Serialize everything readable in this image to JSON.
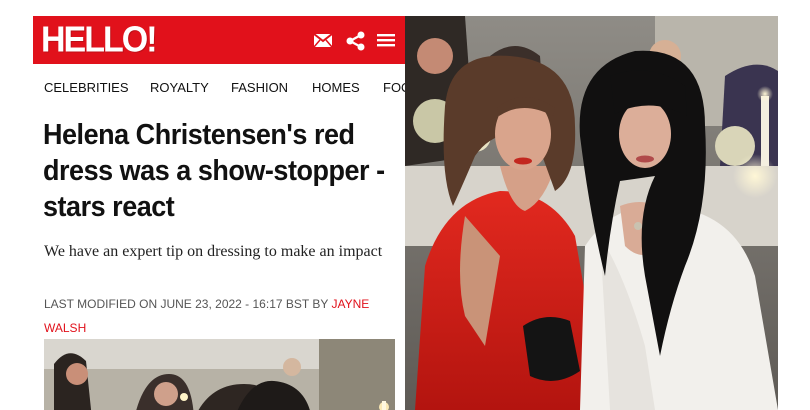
{
  "header": {
    "logo_text": "HELLO!",
    "brand_color": "#e1111b",
    "icons": [
      "mail-icon",
      "share-icon",
      "menu-icon"
    ]
  },
  "nav": {
    "items": [
      "CELEBRITIES",
      "ROYALTY",
      "FASHION",
      "HOMES",
      "FOO"
    ]
  },
  "article": {
    "headline": "Helena Christensen's red dress was a show-stopper - stars react",
    "subheadline": "We have an expert tip on dressing to make an impact",
    "meta_prefix": "LAST MODIFIED ON JUNE 23, 2022 - 16:17 BST BY ",
    "author": "JAYNE WALSH"
  }
}
